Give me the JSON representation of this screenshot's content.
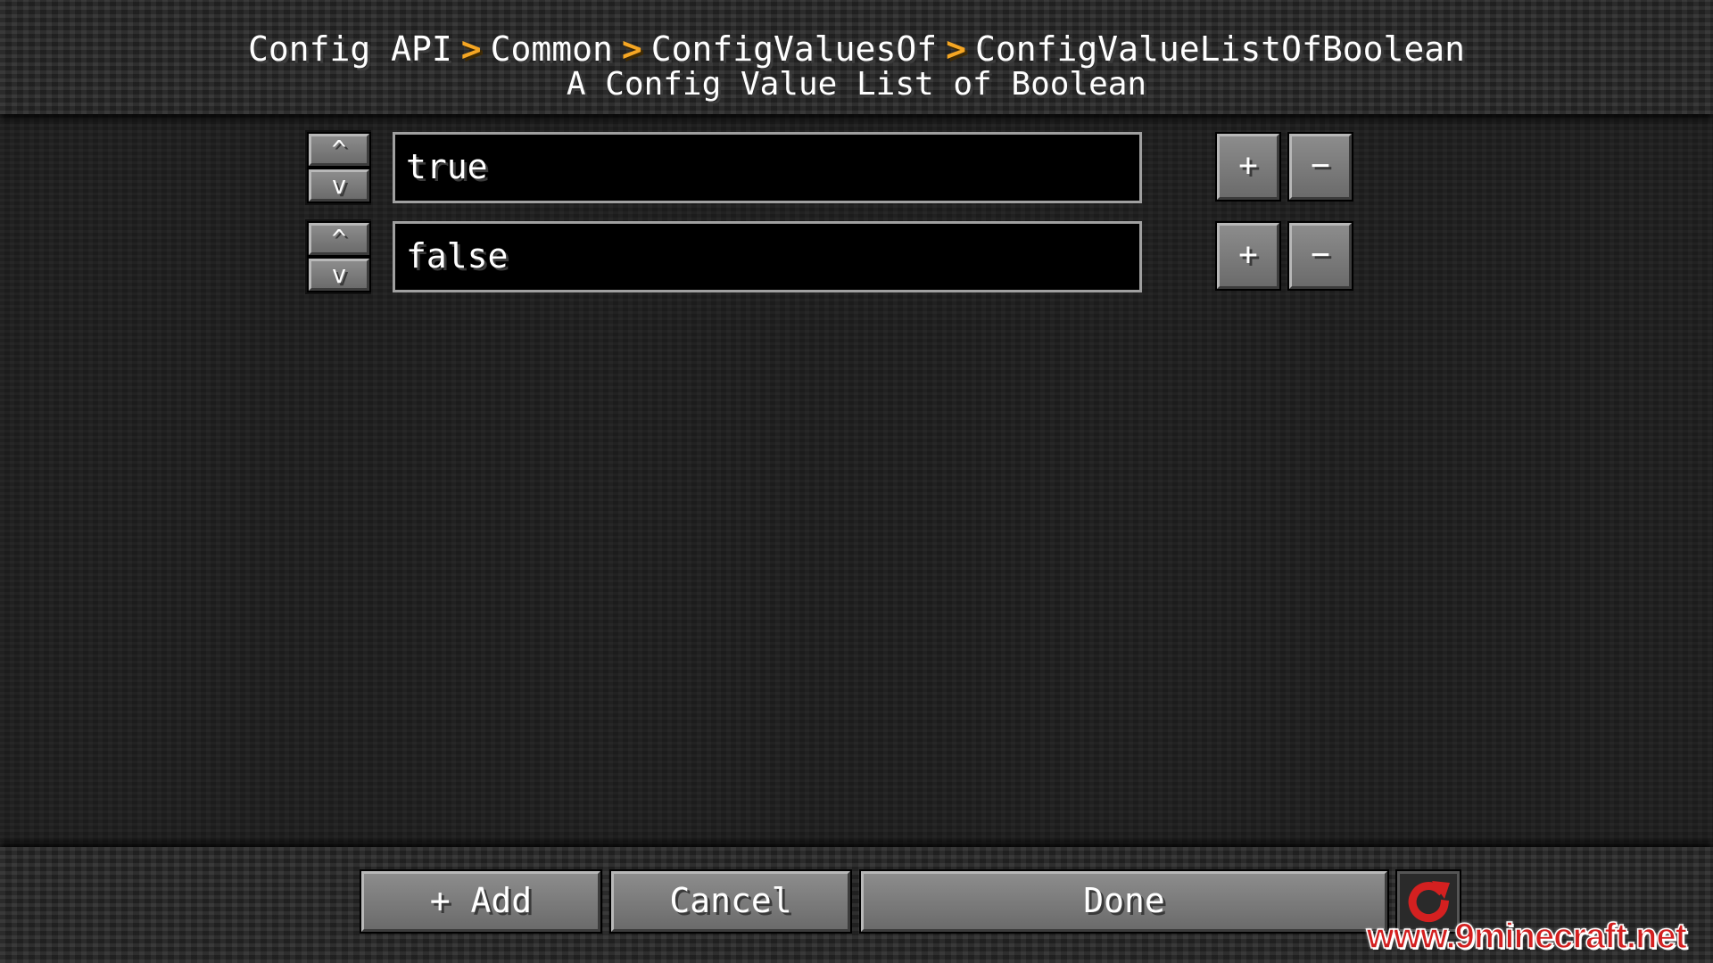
{
  "header": {
    "breadcrumb": [
      "Config API",
      "Common",
      "ConfigValuesOf",
      "ConfigValueListOfBoolean"
    ],
    "separator_icon": "chevron-right-icon",
    "separator_color": "#f5a623",
    "subtitle": "A Config Value List of Boolean"
  },
  "list": {
    "items": [
      {
        "value": "true",
        "move_up_label": "^",
        "move_down_label": "v",
        "add_label": "+",
        "remove_label": "−"
      },
      {
        "value": "false",
        "move_up_label": "^",
        "move_down_label": "v",
        "add_label": "+",
        "remove_label": "−"
      }
    ]
  },
  "footer": {
    "add_label": "+ Add",
    "cancel_label": "Cancel",
    "done_label": "Done",
    "reset_icon": "reset-icon",
    "reset_color": "#d42020"
  },
  "watermark": {
    "text": "www.9minecraft.net",
    "color": "#d31f1f"
  }
}
